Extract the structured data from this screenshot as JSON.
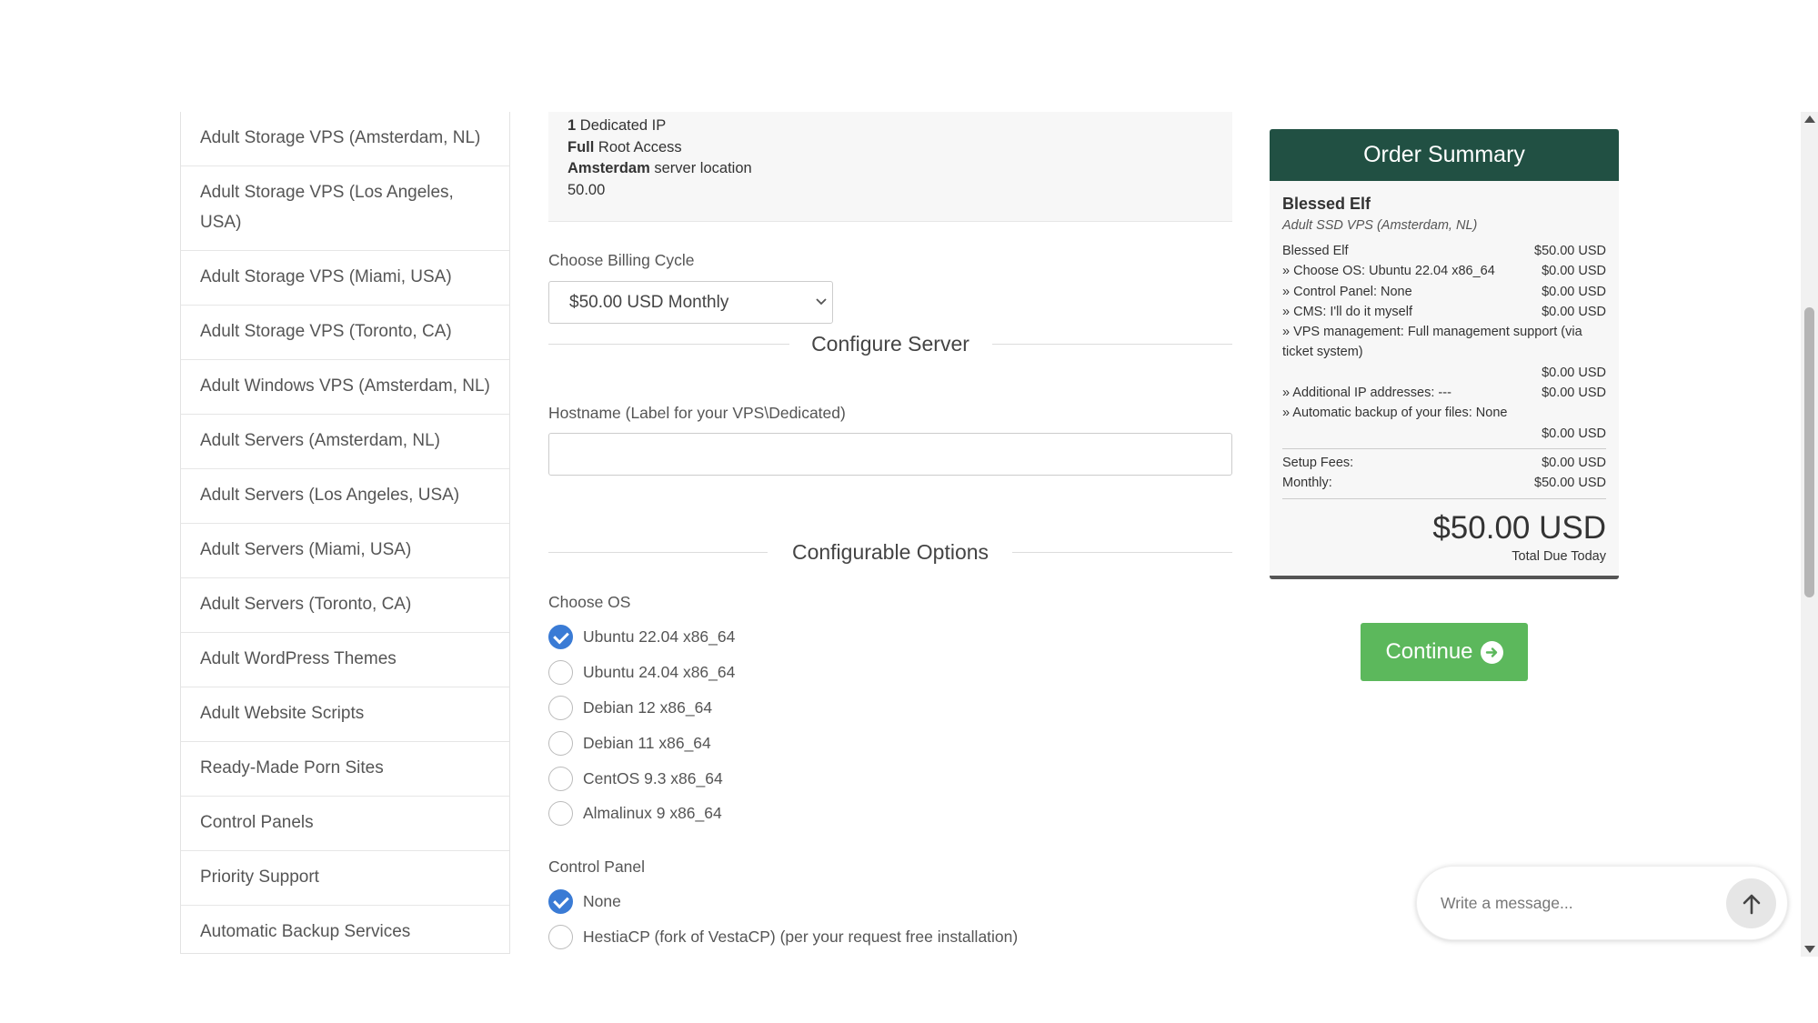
{
  "sidebar": {
    "items": [
      {
        "label": "Adult Storage VPS (Amsterdam, NL)"
      },
      {
        "label": "Adult Storage VPS (Los Angeles, USA)"
      },
      {
        "label": "Adult Storage VPS (Miami, USA)"
      },
      {
        "label": "Adult Storage VPS (Toronto, CA)"
      },
      {
        "label": "Adult Windows VPS (Amsterdam, NL)"
      },
      {
        "label": "Adult Servers (Amsterdam, NL)"
      },
      {
        "label": "Adult Servers (Los Angeles, USA)"
      },
      {
        "label": "Adult Servers (Miami, USA)"
      },
      {
        "label": "Adult Servers (Toronto, CA)"
      },
      {
        "label": "Adult WordPress Themes"
      },
      {
        "label": "Adult Website Scripts"
      },
      {
        "label": "Ready-Made Porn Sites"
      },
      {
        "label": "Control Panels"
      },
      {
        "label": "Priority Support"
      },
      {
        "label": "Automatic Backup Services"
      }
    ]
  },
  "specs": {
    "ip_count": "1",
    "ip_text": " Dedicated IP",
    "root_bold": "Full",
    "root_text": " Root Access",
    "loc_bold": "Amsterdam",
    "loc_text": " server location",
    "price": "50.00"
  },
  "billing": {
    "label": "Choose Billing Cycle",
    "selected": "$50.00 USD Monthly"
  },
  "configure_server": {
    "title": "Configure Server",
    "hostname_label": "Hostname (Label for your VPS\\Dedicated)",
    "hostname_value": ""
  },
  "configurable_options": {
    "title": "Configurable Options",
    "os_label": "Choose OS",
    "os_options": [
      {
        "label": "Ubuntu 22.04 x86_64",
        "checked": true
      },
      {
        "label": "Ubuntu 24.04 x86_64",
        "checked": false
      },
      {
        "label": "Debian 12 x86_64",
        "checked": false
      },
      {
        "label": "Debian 11 x86_64",
        "checked": false
      },
      {
        "label": "CentOS 9.3 x86_64",
        "checked": false
      },
      {
        "label": "Almalinux 9 x86_64",
        "checked": false
      }
    ],
    "panel_label": "Control Panel",
    "panel_options": [
      {
        "label": "None",
        "checked": true
      },
      {
        "label": "HestiaCP (fork of VestaCP) (per your request free installation)",
        "checked": false
      }
    ]
  },
  "summary": {
    "title": "Order Summary",
    "product_name": "Blessed Elf",
    "product_group": "Adult SSD VPS (Amsterdam, NL)",
    "lines": [
      {
        "desc": "Blessed Elf",
        "amount": "$50.00 USD"
      },
      {
        "desc": " » Choose OS: Ubuntu 22.04 x86_64",
        "amount": "$0.00 USD"
      },
      {
        "desc": " » Control Panel: None",
        "amount": "$0.00 USD"
      },
      {
        "desc": " » CMS: I'll do it myself",
        "amount": "$0.00 USD"
      }
    ],
    "vps_mgmt_desc": " » VPS management: Full management support (via ticket system)",
    "vps_mgmt_amount": "$0.00 USD",
    "additional_ip_desc": " » Additional IP addresses: ---",
    "additional_ip_amount": "$0.00 USD",
    "backup_desc": " » Automatic backup of your files: None",
    "backup_amount": "$0.00 USD",
    "setup_label": "Setup Fees:",
    "setup_amount": "$0.00 USD",
    "monthly_label": "Monthly:",
    "monthly_amount": "$50.00 USD",
    "total": "$50.00 USD",
    "total_label": "Total Due Today"
  },
  "continue_label": "Continue",
  "chat": {
    "placeholder": "Write a message..."
  },
  "colors": {
    "summary_header": "#215043",
    "continue": "#5cb85c",
    "radio_checked": "#3a7bd5"
  }
}
